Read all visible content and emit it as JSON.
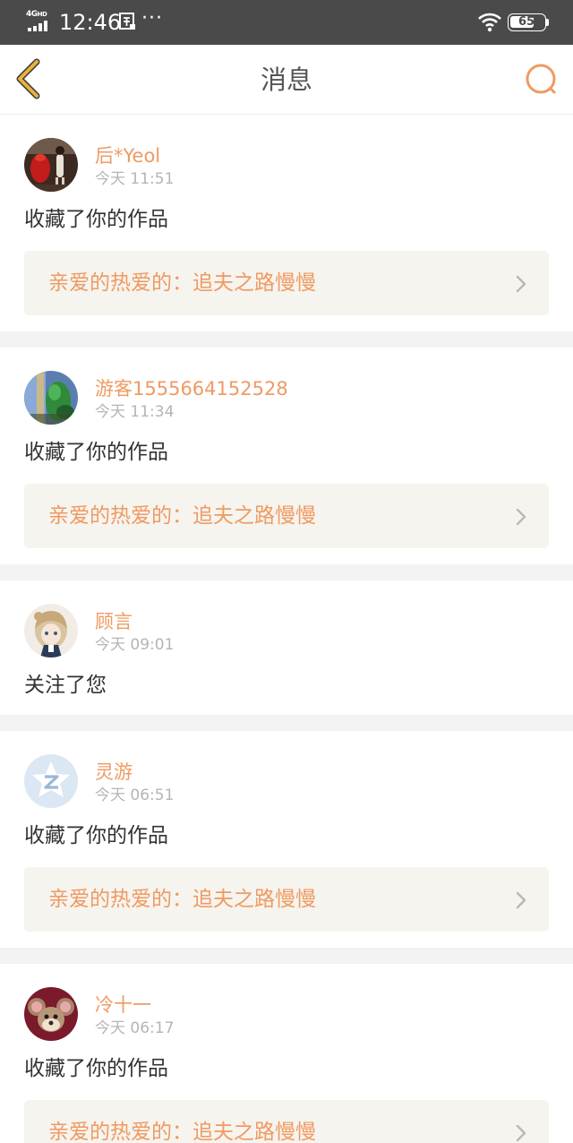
{
  "status_bar": {
    "network": "4G",
    "network_sup": "HD",
    "time": "12:46",
    "more": "···",
    "battery": "65"
  },
  "nav": {
    "title": "消息",
    "back_icon": "chevron-left-icon",
    "search_icon": "search-icon",
    "accent_color": "#e8b23a"
  },
  "messages": [
    {
      "user": "后*Yeol",
      "time": "今天 11:51",
      "action": "收藏了你的作品",
      "work": "亲爱的热爱的：追夫之路慢慢"
    },
    {
      "user": "游客1555664152528",
      "time": "今天 11:34",
      "action": "收藏了你的作品",
      "work": "亲爱的热爱的：追夫之路慢慢"
    },
    {
      "user": "顾言",
      "time": "今天 09:01",
      "action": "关注了您"
    },
    {
      "user": "灵游",
      "time": "今天 06:51",
      "action": "收藏了你的作品",
      "work": "亲爱的热爱的：追夫之路慢慢"
    },
    {
      "user": "冷十一",
      "time": "今天 06:17",
      "action": "收藏了你的作品",
      "work": "亲爱的热爱的：追夫之路慢慢"
    }
  ],
  "colors": {
    "username": "#ef9a63",
    "link_bg": "#f6f4ee",
    "status_bar_bg": "#4a4a4a"
  }
}
